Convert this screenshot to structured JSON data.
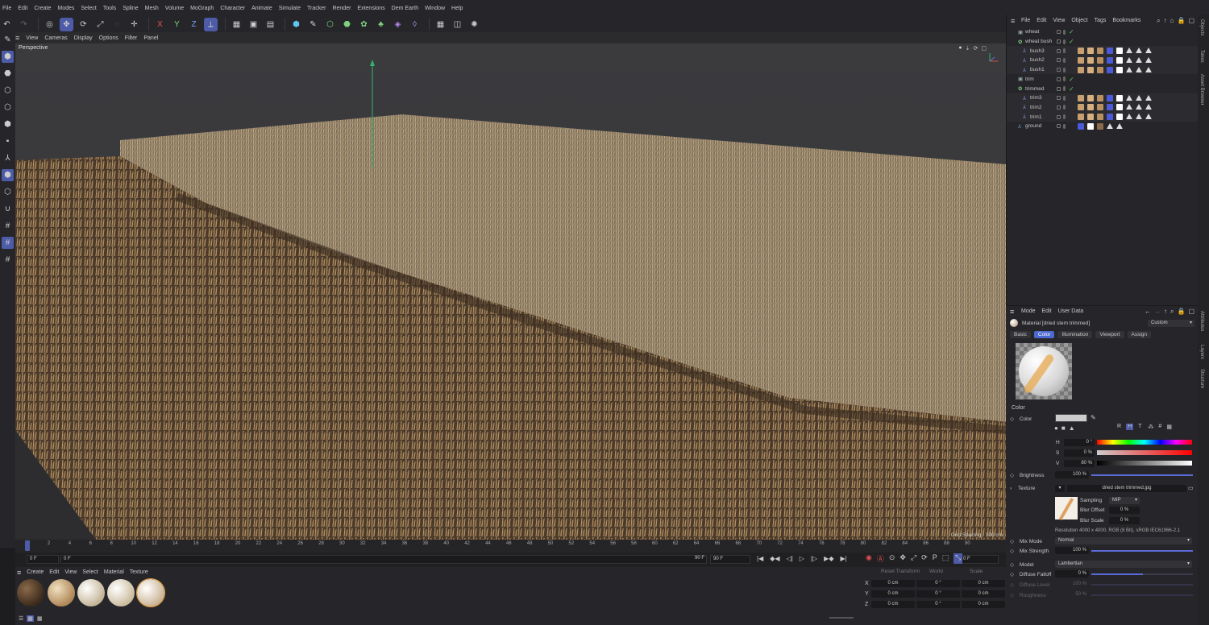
{
  "menubar": [
    "File",
    "Edit",
    "Create",
    "Modes",
    "Select",
    "Tools",
    "Spline",
    "Mesh",
    "Volume",
    "MoGraph",
    "Character",
    "Animate",
    "Simulate",
    "Tracker",
    "Render",
    "Extensions",
    "Dem Earth",
    "Window",
    "Help"
  ],
  "toolbar": {
    "x_label": "X",
    "y_label": "Y",
    "z_label": "Z"
  },
  "viewport": {
    "menu": [
      "View",
      "Cameras",
      "Display",
      "Options",
      "Filter",
      "Panel"
    ],
    "mode_label": "Perspective",
    "grid_spacing": "Grid Spacing : 100 cm"
  },
  "timeline": {
    "ticks": [
      "0",
      "2",
      "4",
      "6",
      "8",
      "10",
      "12",
      "14",
      "16",
      "18",
      "20",
      "22",
      "24",
      "26",
      "28",
      "30",
      "32",
      "34",
      "36",
      "38",
      "40",
      "42",
      "44",
      "46",
      "48",
      "50",
      "52",
      "54",
      "56",
      "58",
      "60",
      "62",
      "64",
      "66",
      "68",
      "70",
      "72",
      "74",
      "76",
      "78",
      "80",
      "82",
      "84",
      "86",
      "88",
      "90"
    ],
    "start_frame": "0 F",
    "current_frame": "0 F",
    "end_frame": "90 F",
    "end_frame_box": "90 F",
    "right_frame": "0 F"
  },
  "materials": {
    "menu": [
      "Create",
      "Edit",
      "View",
      "Select",
      "Material",
      "Texture"
    ]
  },
  "coordinates": {
    "headers": [
      "Reset Transform",
      "World",
      "Scale"
    ],
    "rows": [
      {
        "axis": "X",
        "pos": "0 cm",
        "rot": "0 °",
        "size": "0 cm"
      },
      {
        "axis": "Y",
        "pos": "0 cm",
        "rot": "0 °",
        "size": "0 cm"
      },
      {
        "axis": "Z",
        "pos": "0 cm",
        "rot": "0 °",
        "size": "0 cm"
      }
    ]
  },
  "objects": {
    "menu": [
      "File",
      "Edit",
      "View",
      "Object",
      "Tags",
      "Bookmarks"
    ],
    "items": [
      {
        "name": "wheat"
      },
      {
        "name": "wheat bush"
      },
      {
        "name": "bush3"
      },
      {
        "name": "bush2"
      },
      {
        "name": "bush1"
      },
      {
        "name": "trim"
      },
      {
        "name": "trimmed"
      },
      {
        "name": "trim3"
      },
      {
        "name": "trim2"
      },
      {
        "name": "trim1"
      },
      {
        "name": "ground"
      }
    ]
  },
  "attributes": {
    "menu": [
      "Mode",
      "Edit",
      "User Data"
    ],
    "material_title": "Material [dried stem trimmed]",
    "preset": "Custom",
    "tabs": [
      "Basic",
      "Color",
      "Illumination",
      "Viewport",
      "Assign"
    ],
    "section": "Color",
    "color_label": "Color",
    "mode_buttons": [
      "R",
      "H",
      "T"
    ],
    "h_label": "H",
    "h_value": "0 °",
    "s_label": "S",
    "s_value": "0 %",
    "v_label": "V",
    "v_value": "80 %",
    "brightness_label": "Brightness",
    "brightness_value": "100 %",
    "texture_label": "Texture",
    "texture_file": "dried stem trimmed.jpg",
    "sampling_label": "Sampling",
    "sampling_value": "MIP",
    "blur_offset_label": "Blur Offset",
    "blur_offset_value": "0 %",
    "blur_scale_label": "Blur Scale",
    "blur_scale_value": "0 %",
    "resolution": "Resolution 4000 x 4000, RGB (8 Bit), sRGB IEC61966-2.1",
    "mix_mode_label": "Mix Mode",
    "mix_mode_value": "Normal",
    "mix_strength_label": "Mix Strength",
    "mix_strength_value": "100 %",
    "model_label": "Model",
    "model_value": "Lambertian",
    "diffuse_falloff_label": "Diffuse Falloff",
    "diffuse_falloff_value": "0 %",
    "diffuse_level_label": "Diffuse Level",
    "diffuse_level_value": "100 %",
    "roughness_label": "Roughness",
    "roughness_value": "50 %"
  },
  "right_strip": [
    "Objects",
    "Takes",
    "Asset Browser",
    "Attributes",
    "Layers",
    "Structure"
  ]
}
